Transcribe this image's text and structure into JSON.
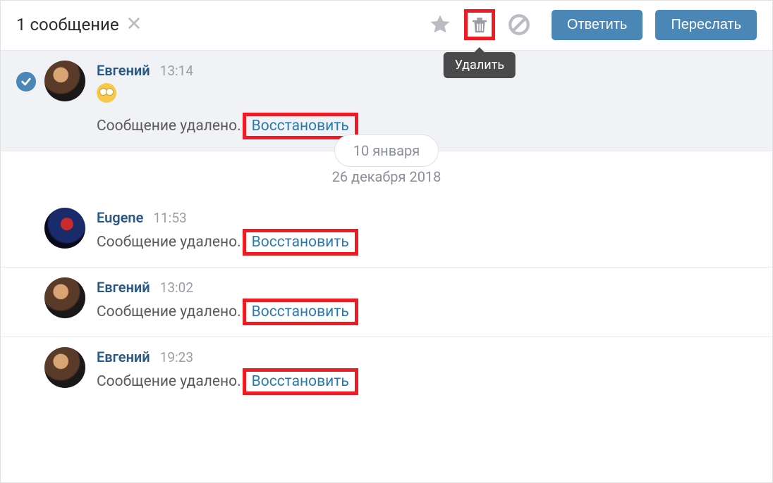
{
  "topbar": {
    "selection_label": "1 сообщение",
    "reply_label": "Ответить",
    "forward_label": "Переслать",
    "tooltip_delete": "Удалить"
  },
  "dates": {
    "pill": "10 января",
    "line": "26 декабря 2018"
  },
  "messages": [
    {
      "author": "Евгений",
      "time": "13:14",
      "selected": true,
      "avatar": "ev",
      "has_emoji": true,
      "deleted_text": "Сообщение удалено.",
      "restore_text": "Восстановить"
    },
    {
      "author": "Eugene",
      "time": "11:53",
      "avatar": "eu",
      "deleted_text": "Сообщение удалено.",
      "restore_text": "Восстановить"
    },
    {
      "author": "Евгений",
      "time": "13:02",
      "avatar": "ev",
      "deleted_text": "Сообщение удалено.",
      "restore_text": "Восстановить"
    },
    {
      "author": "Евгений",
      "time": "19:23",
      "avatar": "ev",
      "deleted_text": "Сообщение удалено.",
      "restore_text": "Восстановить"
    }
  ]
}
